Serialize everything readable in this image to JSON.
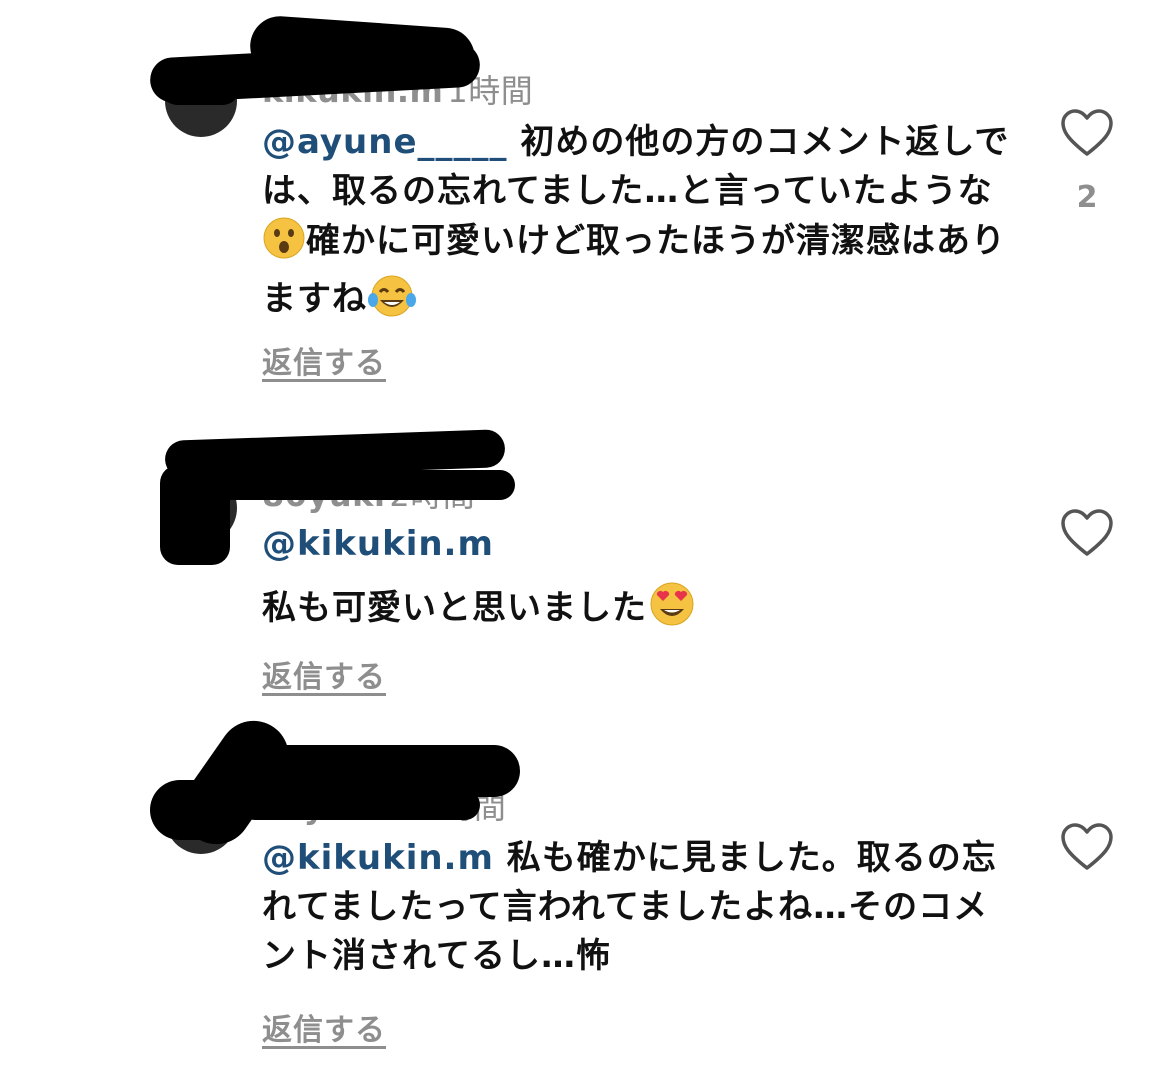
{
  "comments": [
    {
      "username": "kikukin.m",
      "time": "1時間",
      "mention": "@ayune_____",
      "text": " 初めの他の方のコメント返しでは、取るの忘れてました…と言っていたような",
      "emoji1": "surprised-face-emoji",
      "text2": "確かに可愛いけど取ったほうが清潔感はありますね",
      "emoji2": "tears-of-joy-emoji",
      "reply_label": "返信する",
      "like_count": "2"
    },
    {
      "username": "80yuki",
      "time": "2時間",
      "mention": "@kikukin.m",
      "text": "私も可愛いと思いました",
      "emoji1": "heart-eyes-emoji",
      "reply_label": "返信する"
    },
    {
      "username": "acyn153",
      "time": "1時間",
      "mention": "@kikukin.m",
      "text": " 私も確かに見ました。取るの忘れてましたって言われてましたよね…そのコメント消されてるし…怖",
      "reply_label": "返信する"
    }
  ],
  "colors": {
    "mention": "#1f4e79",
    "secondary": "#8e8e8e",
    "text": "#111111"
  }
}
